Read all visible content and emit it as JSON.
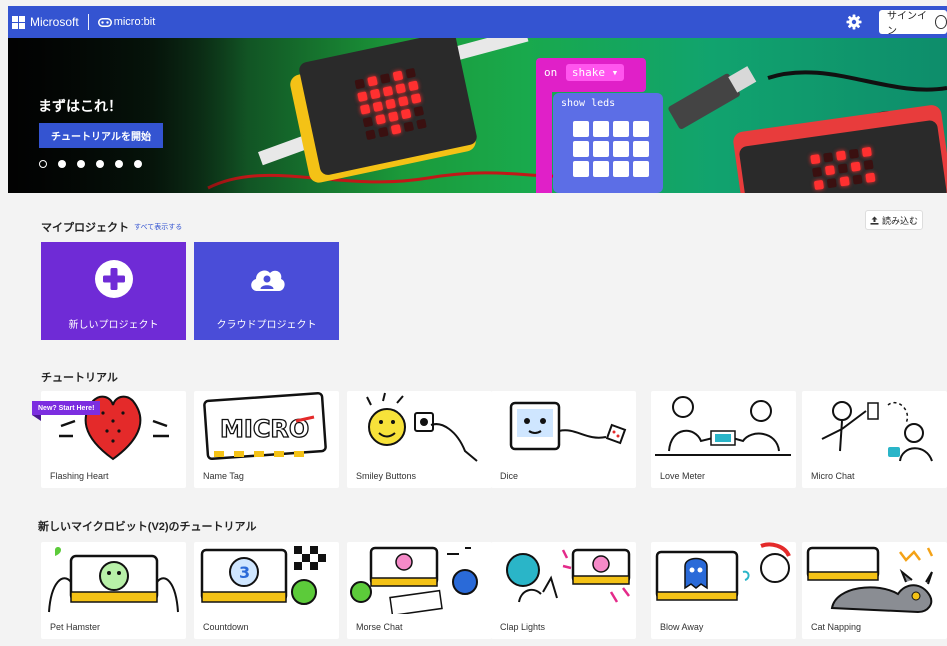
{
  "header": {
    "brand": "Microsoft",
    "product": "micro:bit",
    "signin_label": "サインイン",
    "bar_color": "#3454d1"
  },
  "hero": {
    "title": "まずはこれ！",
    "button_label": "チュートリアルを開始",
    "slide_count": 6,
    "active_slide": 1,
    "block_on_label": "on",
    "block_shake_label": "shake ▾",
    "block_leds_label": "show leds"
  },
  "my_projects": {
    "title": "マイプロジェクト",
    "see_all": "すべて表示する",
    "import_label": "読み込む",
    "cards": [
      {
        "label": "新しいプロジェクト",
        "icon": "plus-circle-icon",
        "color": "#6f2bd6"
      },
      {
        "label": "クラウドプロジェクト",
        "icon": "cloud-user-icon",
        "color": "#4a4dd8"
      }
    ]
  },
  "tutorials": {
    "title": "チュートリアル",
    "badge": "New? Start Here!",
    "items": [
      "Flashing Heart",
      "Name Tag",
      "Smiley Buttons",
      "Dice",
      "Love Meter",
      "Micro Chat"
    ]
  },
  "v2_tutorials": {
    "title": "新しいマイクロビット(V2)のチュートリアル",
    "items": [
      "Pet Hamster",
      "Countdown",
      "Morse Chat",
      "Clap Lights",
      "Blow Away",
      "Cat Napping"
    ]
  }
}
